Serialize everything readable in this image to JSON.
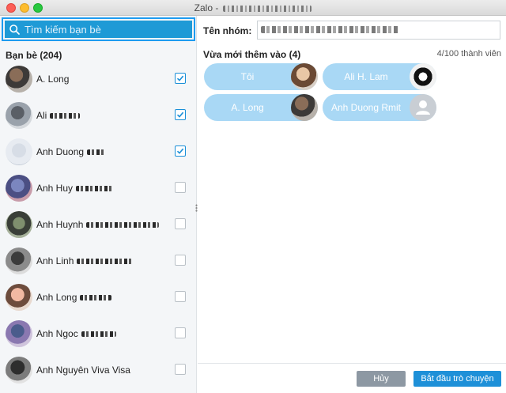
{
  "window": {
    "title": "Zalo -"
  },
  "search": {
    "placeholder": "Tìm kiếm bạn bè",
    "value": ""
  },
  "friends": {
    "header": "Bạn bè (204)",
    "items": [
      {
        "name": "A. Long",
        "checked": true
      },
      {
        "name": "Ali",
        "checked": true
      },
      {
        "name": "Anh Duong",
        "checked": true
      },
      {
        "name": "Anh Huy",
        "checked": false
      },
      {
        "name": "Anh Huynh",
        "checked": false
      },
      {
        "name": "Anh Linh",
        "checked": false
      },
      {
        "name": "Anh Long",
        "checked": false
      },
      {
        "name": "Anh Ngoc",
        "checked": false
      },
      {
        "name": "Anh Nguyên Viva Visa",
        "checked": false
      }
    ]
  },
  "group": {
    "name_label": "Tên nhóm:"
  },
  "added": {
    "header": "Vừa mới thêm vào (4)",
    "count": "4/100 thành viên",
    "members": [
      {
        "label": "Tôi"
      },
      {
        "label": "Ali H. Lam"
      },
      {
        "label": "A. Long"
      },
      {
        "label": "Anh Duong Rmit"
      }
    ]
  },
  "buttons": {
    "cancel": "Hủy",
    "start": "Bắt đầu trò chuyện"
  },
  "colors": {
    "accent": "#1e90d8",
    "chip": "#a9d8f5",
    "cancel": "#8d98a3"
  },
  "icons": {
    "search": "search-icon",
    "check": "checkmark-icon",
    "placeholder": "user-placeholder-icon"
  }
}
